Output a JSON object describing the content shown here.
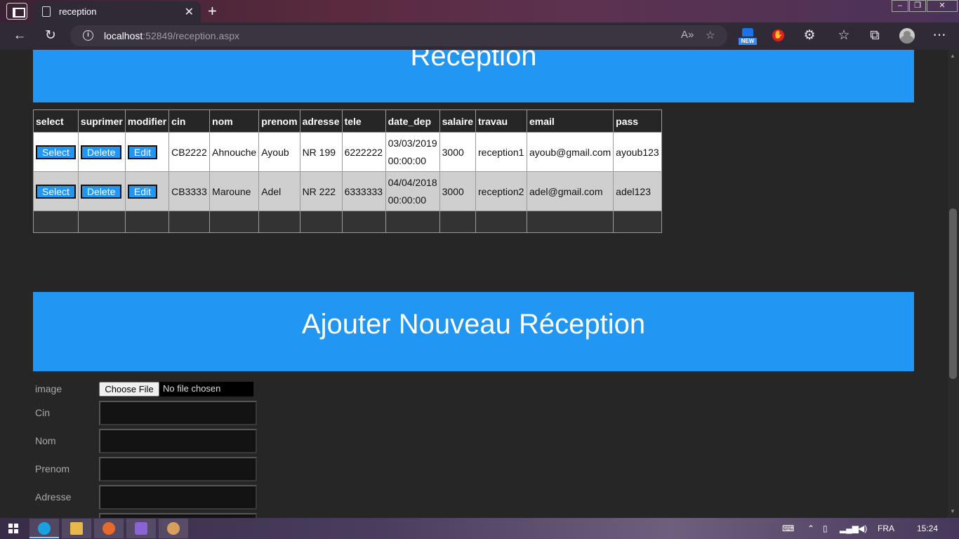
{
  "browser": {
    "tab_title": "reception",
    "url_host": "localhost",
    "url_rest": ":52849/reception.aspx",
    "ext_badge": "NEW"
  },
  "page": {
    "top_banner_title": "Reception",
    "add_banner_title": "Ajouter Nouveau Réception"
  },
  "table": {
    "headers": [
      "select",
      "suprimer",
      "modifier",
      "cin",
      "nom",
      "prenom",
      "adresse",
      "tele",
      "date_dep",
      "salaire",
      "travau",
      "email",
      "pass"
    ],
    "button_labels": {
      "select": "Select",
      "delete": "Delete",
      "edit": "Edit"
    },
    "rows": [
      {
        "cin": "CB2222",
        "nom": "Ahnouche",
        "prenom": "Ayoub",
        "adresse": "NR 199",
        "tele": "6222222",
        "date": "03/03/2019",
        "time": "00:00:00",
        "salaire": "3000",
        "travau": "reception1",
        "email": "ayoub@gmail.com",
        "pass": "ayoub123"
      },
      {
        "cin": "CB3333",
        "nom": "Maroune",
        "prenom": "Adel",
        "adresse": "NR 222",
        "tele": "6333333",
        "date": "04/04/2018",
        "time": "00:00:00",
        "salaire": "3000",
        "travau": "reception2",
        "email": "adel@gmail.com",
        "pass": "adel123"
      }
    ]
  },
  "form": {
    "image_label": "image",
    "choose_file": "Choose File",
    "no_file": "No file chosen",
    "labels": [
      "Cin",
      "Nom",
      "Prenom",
      "Adresse"
    ]
  },
  "taskbar": {
    "language": "FRA",
    "clock": "15:24"
  },
  "colors": {
    "accent": "#2196f3",
    "page_bg": "#262626"
  }
}
